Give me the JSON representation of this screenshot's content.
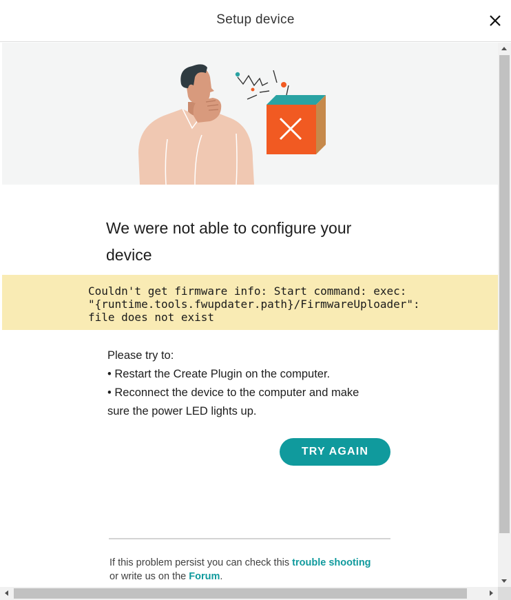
{
  "dialog": {
    "title": "Setup device",
    "close_icon": "close-icon"
  },
  "illustration": {
    "name": "confused-person-with-failed-device-illustration",
    "error_icon": "x-icon",
    "colors": {
      "box": "#f15a22",
      "box_top": "#2aa3a3",
      "box_side": "#c6894b",
      "skin": "#d89a7d",
      "hair": "#2f3b41",
      "shirt": "#f0c8b2"
    }
  },
  "message": {
    "heading": "We were not able to configure your device"
  },
  "error": {
    "text": "Couldn't get firmware info: Start command: exec:\n\"{runtime.tools.fwupdater.path}/FirmwareUploader\":\nfile does not exist",
    "background": "#f9ebb4"
  },
  "tips": {
    "intro": "Please try to:",
    "items": [
      "• Restart the Create Plugin on the computer.",
      "• Reconnect the device to the computer and make sure the power LED lights up."
    ]
  },
  "actions": {
    "try_again_label": "TRY AGAIN",
    "accent": "#109a9d"
  },
  "footer": {
    "text_before": "If this problem persist you can check this ",
    "trouble_link": "trouble shooting",
    "text_middle": "or write us on the ",
    "forum_link": "Forum",
    "text_after": "."
  }
}
